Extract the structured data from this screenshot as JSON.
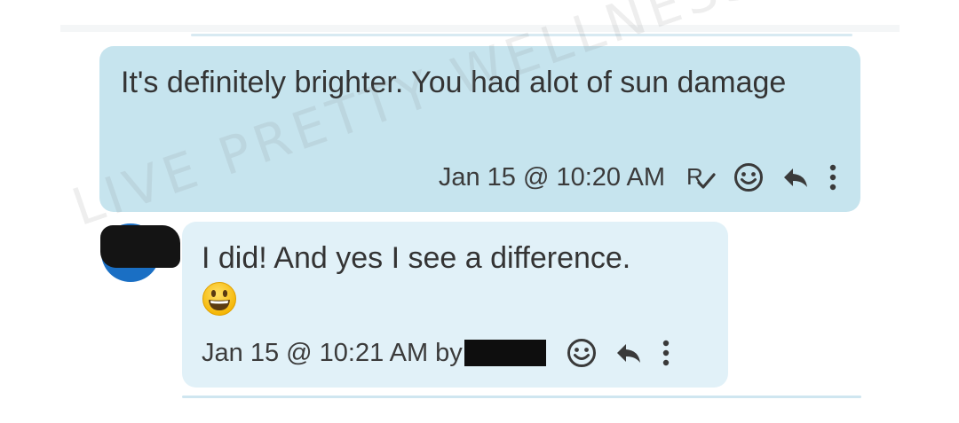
{
  "messages": [
    {
      "text": "It's definitely brighter. You had alot of sun damage",
      "timestamp": "Jan 15 @ 10:20 AM",
      "icons": [
        "read-receipt-icon",
        "emoji-reaction-icon",
        "reply-icon",
        "more-options-icon"
      ]
    },
    {
      "text": "I did! And yes I see a difference.",
      "emoji": "grinning-face-emoji",
      "timestamp": "Jan 15 @ 10:21 AM",
      "by_label": "by",
      "icons": [
        "emoji-reaction-icon",
        "reply-icon",
        "more-options-icon"
      ]
    }
  ],
  "watermark": "LIVE PRETTY WELLNESS",
  "colors": {
    "outgoing_bubble": "#c6e4ee",
    "incoming_bubble": "#e1f1f8",
    "avatar": "#1a6fc4",
    "icon": "#3a3a3a",
    "text": "#343434"
  }
}
